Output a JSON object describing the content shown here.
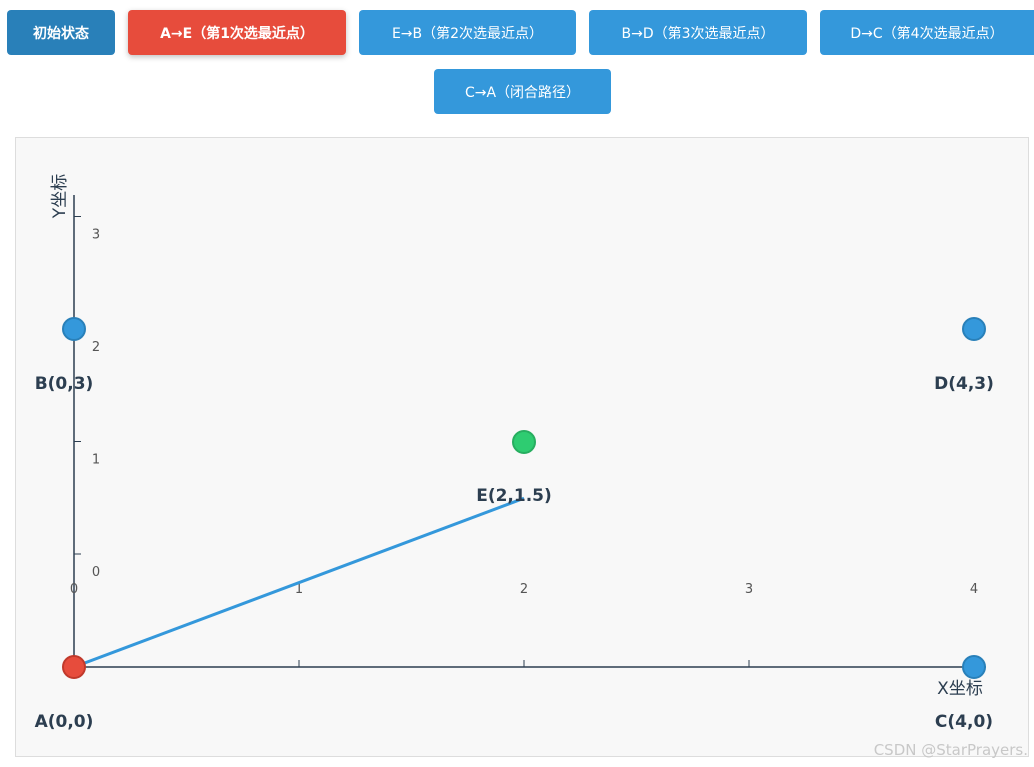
{
  "buttons": [
    {
      "label": "初始状态",
      "state": "default"
    },
    {
      "label": "A→E（第1次选最近点）",
      "state": "active"
    },
    {
      "label": "E→B（第2次选最近点）",
      "state": "default"
    },
    {
      "label": "B→D（第3次选最近点）",
      "state": "default"
    },
    {
      "label": "D→C（第4次选最近点）",
      "state": "default"
    },
    {
      "label": "C→A（闭合路径）",
      "state": "default"
    }
  ],
  "chart": {
    "x_axis_label": "X坐标",
    "y_axis_label": "Y坐标",
    "x_ticks": [
      "0",
      "1",
      "2",
      "3",
      "4"
    ],
    "y_ticks": [
      "0",
      "1",
      "2",
      "3"
    ],
    "points": [
      {
        "id": "A",
        "label": "A(0,0)",
        "x": 0,
        "y": 0,
        "color": "#e74c3c"
      },
      {
        "id": "B",
        "label": "B(0,3)",
        "x": 0,
        "y": 3,
        "color": "#3498db"
      },
      {
        "id": "C",
        "label": "C(4,0)",
        "x": 4,
        "y": 0,
        "color": "#3498db"
      },
      {
        "id": "D",
        "label": "D(4,3)",
        "x": 4,
        "y": 3,
        "color": "#3498db"
      },
      {
        "id": "E",
        "label": "E(2,1.5)",
        "x": 2,
        "y": 1.5,
        "color": "#2ecc71"
      }
    ],
    "path": [
      [
        "A",
        "E"
      ]
    ],
    "path_color": "#3498db"
  },
  "colors": {
    "button": "#3498db",
    "button_dark": "#2980b9",
    "button_active": "#e74c3c",
    "axis": "#2c3e50"
  },
  "watermark": "CSDN @StarPrayers."
}
